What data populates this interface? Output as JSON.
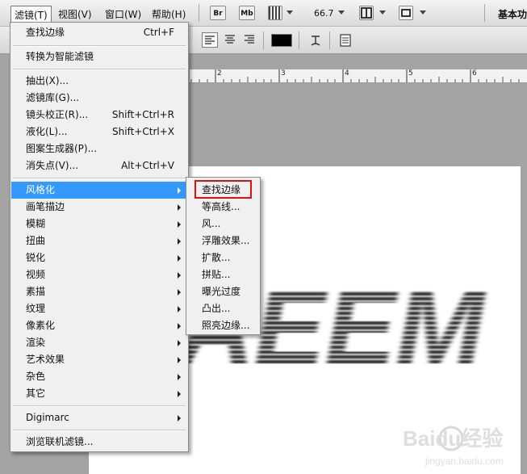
{
  "menubar": {
    "items": [
      "滤镜(T)",
      "视图(V)",
      "窗口(W)",
      "帮助(H)"
    ],
    "bridge_label": "Br",
    "minibridge_label": "Mb",
    "zoom_value": "66.7",
    "workspace_label": "基本功"
  },
  "filter_menu": {
    "top": [
      {
        "label": "查找边缘",
        "shortcut": "Ctrl+F"
      }
    ],
    "smart": [
      {
        "label": "转换为智能滤镜"
      }
    ],
    "special": [
      {
        "label": "抽出(X)..."
      },
      {
        "label": "滤镜库(G)..."
      },
      {
        "label": "镜头校正(R)...",
        "shortcut": "Shift+Ctrl+R"
      },
      {
        "label": "液化(L)...",
        "shortcut": "Shift+Ctrl+X"
      },
      {
        "label": "图案生成器(P)..."
      },
      {
        "label": "消失点(V)...",
        "shortcut": "Alt+Ctrl+V"
      }
    ],
    "groups": [
      "风格化",
      "画笔描边",
      "模糊",
      "扭曲",
      "锐化",
      "视频",
      "素描",
      "纹理",
      "像素化",
      "渲染",
      "艺术效果",
      "杂色",
      "其它"
    ],
    "digimarc": "Digimarc",
    "browse": "浏览联机滤镜..."
  },
  "stylize_submenu": {
    "items": [
      "查找边缘",
      "等高线...",
      "风...",
      "浮雕效果...",
      "扩散...",
      "拼贴...",
      "曝光过度",
      "凸出...",
      "照亮边缘..."
    ]
  },
  "ruler": {
    "ticks": [
      "2",
      "3",
      "4",
      "5",
      "6"
    ]
  },
  "canvas": {
    "art_text": "AEEM"
  },
  "watermark": {
    "logo": "Baidu经验",
    "url": "jingyan.baidu.com"
  },
  "colors": {
    "highlight": "#3399ff",
    "annotation": "#e01010"
  }
}
